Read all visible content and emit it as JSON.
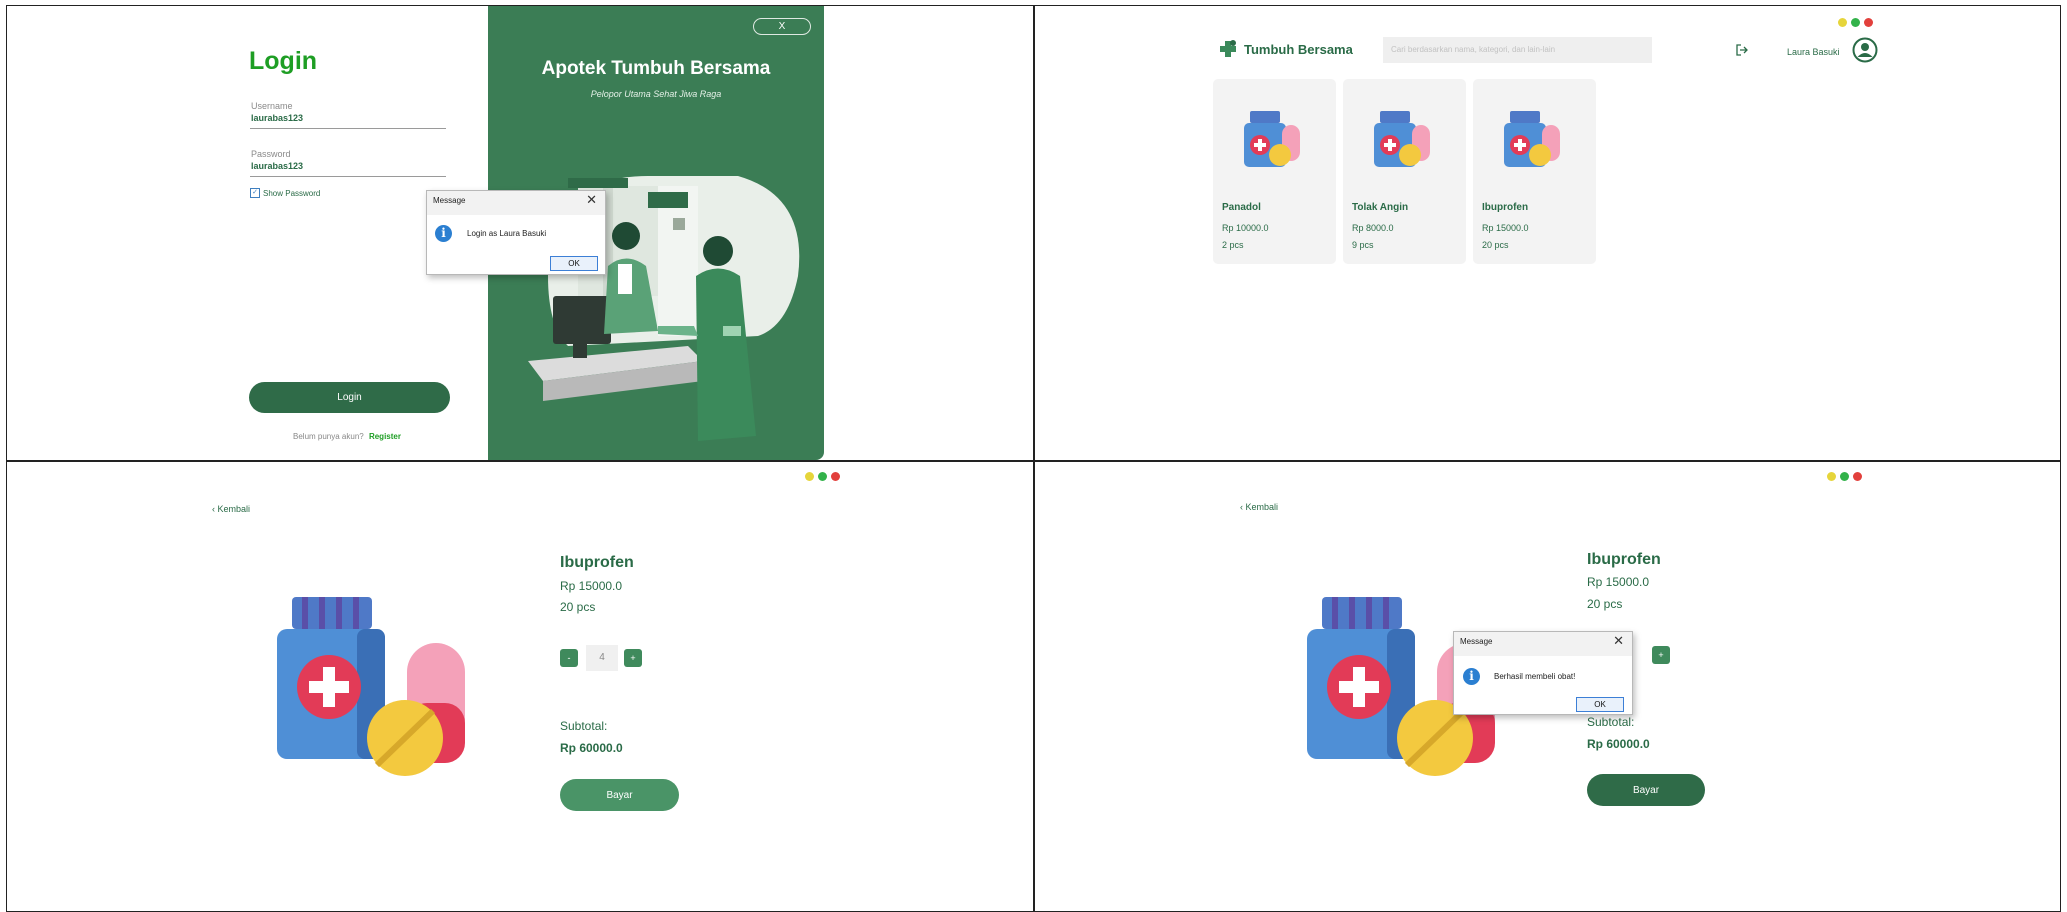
{
  "login": {
    "title": "Login",
    "username_label": "Username",
    "username_value": "laurabas123",
    "password_label": "Password",
    "password_value": "laurabas123",
    "show_password": "Show Password",
    "login_button": "Login",
    "register_prompt": "Belum punya akun?",
    "register_link": "Register",
    "brand_title": "Apotek Tumbuh Bersama",
    "brand_subtitle": "Pelopor Utama Sehat Jiwa Raga",
    "close_label": "X",
    "dialog": {
      "title": "Message",
      "text": "Login as Laura Basuki",
      "ok": "OK"
    }
  },
  "dashboard": {
    "brand": "Tumbuh Bersama",
    "search_placeholder": "Cari berdasarkan nama, kategori, dan lain-lain",
    "user_name": "Laura Basuki",
    "products": [
      {
        "name": "Panadol",
        "price": "Rp 10000.0",
        "stock": "2 pcs"
      },
      {
        "name": "Tolak Angin",
        "price": "Rp 8000.0",
        "stock": "9 pcs"
      },
      {
        "name": "Ibuprofen",
        "price": "Rp 15000.0",
        "stock": "20 pcs"
      }
    ]
  },
  "detail": {
    "back": "Kembali",
    "name": "Ibuprofen",
    "price": "Rp 15000.0",
    "stock": "20 pcs",
    "minus": "-",
    "plus": "+",
    "quantity": "4",
    "subtotal_label": "Subtotal:",
    "subtotal_value": "Rp 60000.0",
    "pay_button": "Bayar"
  },
  "purchase_dialog": {
    "title": "Message",
    "text": "Berhasil membeli obat!",
    "ok": "OK"
  },
  "colors": {
    "primary": "#2f6b48",
    "pane": "#3b7d55",
    "accent": "#1aa51a"
  }
}
